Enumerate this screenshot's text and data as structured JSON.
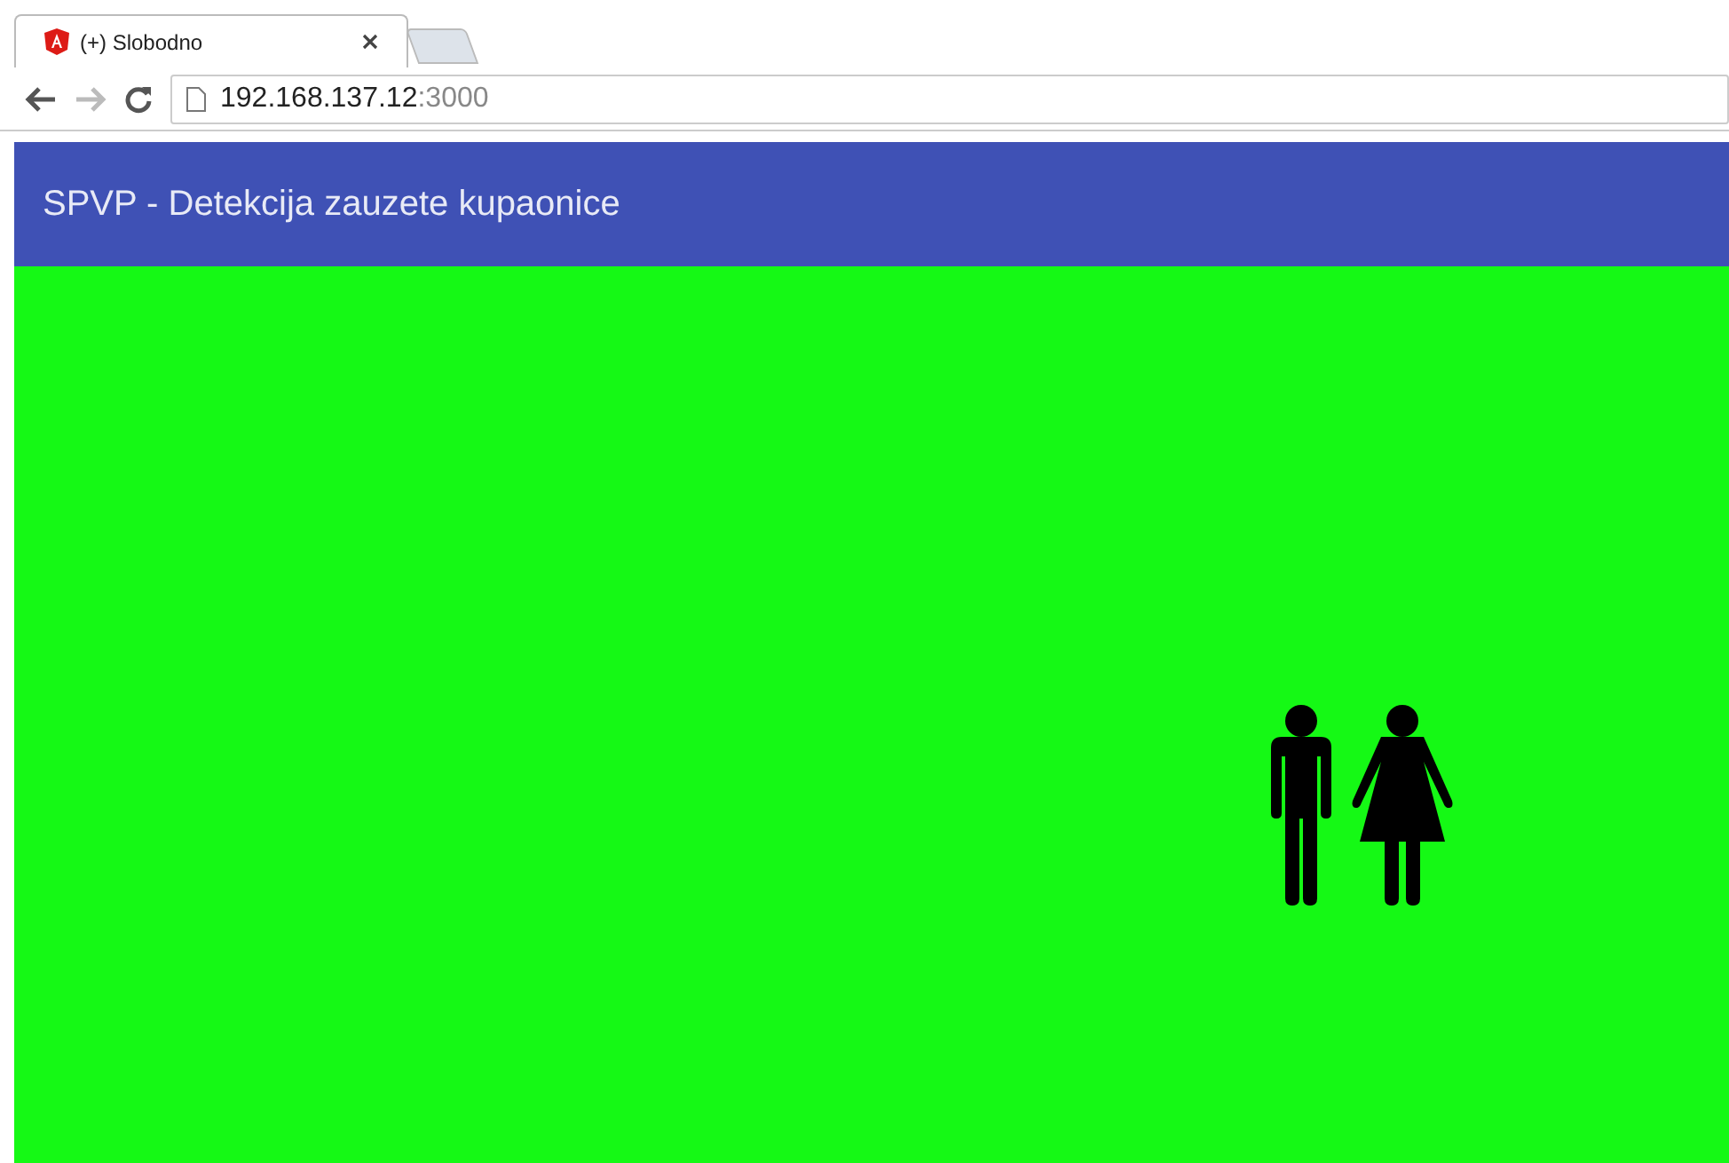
{
  "browser": {
    "tab_title": "(+) Slobodno",
    "url_host": "192.168.137.12",
    "url_port": ":3000"
  },
  "toolbar": {
    "title": "SPVP - Detekcija zauzete kupaonice"
  },
  "status": {
    "occupied": false
  }
}
